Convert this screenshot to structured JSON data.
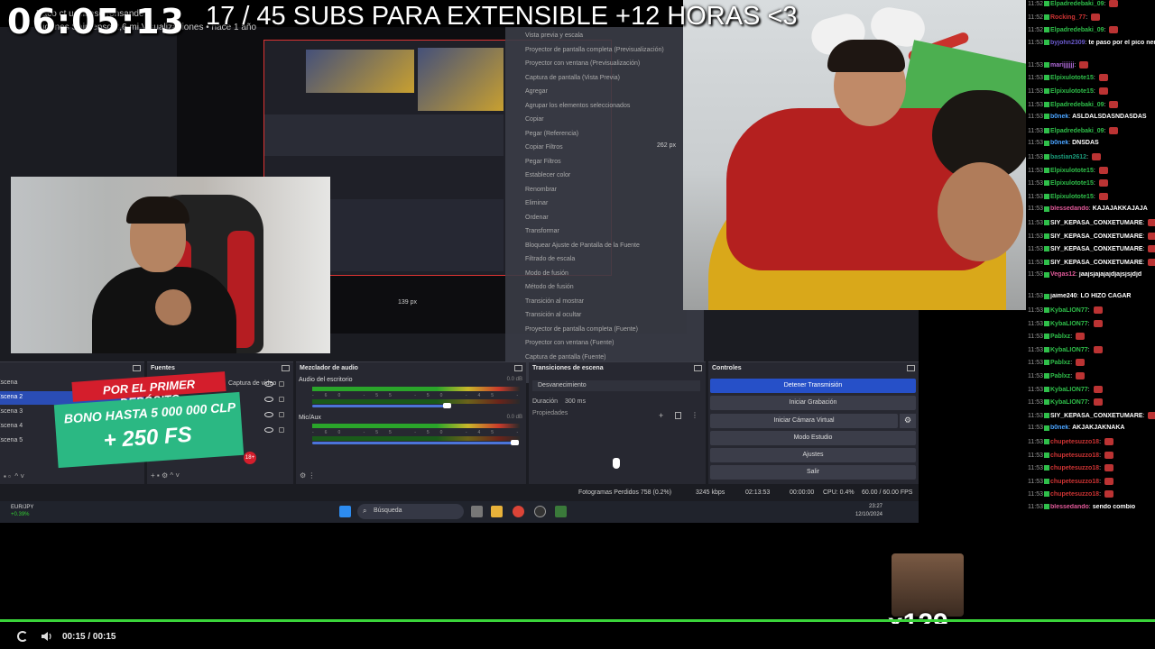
{
  "overlay": {
    "timer": "06:05:13",
    "subs_goal": "17 / 45 SUBS PARA EXTENSIBLE +12 HORAS <3",
    "title_line1": "Paco ct        ucfilfiasd        ronsando",
    "title_line2": "cliganes Saimenso 2,6 mi Visualizaciones • hace 1 año"
  },
  "preview": {
    "px_label_1": "139 px",
    "px_label_2": "262 px",
    "context_menu_items": [
      "Vista previa y escala",
      "Proyector de pantalla completa (Previsualización)",
      "Proyector con ventana (Previsualización)",
      "Captura de pantalla (Vista Previa)",
      "Agregar",
      "Agrupar los elementos seleccionados",
      "Copiar",
      "Pegar (Referencia)",
      "Copiar Filtros",
      "Pegar Filtros",
      "Establecer color",
      "Renombrar",
      "Eliminar",
      "Ordenar",
      "Transformar",
      "Bloquear Ajuste de Pantalla de la Fuente",
      "Filtrado de escala",
      "Modo de fusión",
      "Método de fusión",
      "Transición al mostrar",
      "Transición al ocultar",
      "Proyector de pantalla completa (Fuente)",
      "Proyector con ventana (Fuente)",
      "Captura de pantalla (Fuente)"
    ]
  },
  "docks": {
    "escenas": {
      "title": "",
      "items": [
        "Escena",
        "Escena 2",
        "Escena 3",
        "Escena 4",
        "Escena 5"
      ],
      "active_index": 1
    },
    "fuentes": {
      "title": "Fuentes",
      "items": [
        "Captura de video",
        "",
        "",
        ""
      ]
    },
    "mezclador": {
      "title": "Mezclador de audio",
      "channels": [
        {
          "label": "Audio del escritorio",
          "db": "0.0 dB",
          "level": 0.65
        },
        {
          "label": "Mic/Aux",
          "db": "0.0 dB",
          "level": 0.98
        }
      ],
      "scale": "-60 -55 -50 -45 -40 -35 -30 -25 -20 -15 -10 -5 0"
    },
    "transiciones": {
      "title": "Transiciones de escena",
      "transition": "Desvanecimiento",
      "duration_label": "Duración",
      "duration_value": "300 ms",
      "properties": "Propiedades"
    },
    "controles": {
      "title": "Controles",
      "buttons": [
        "Detener Transmisión",
        "Iniciar Grabación",
        "Iniciar Cámara Virtual",
        "Modo Estudio",
        "Ajustes",
        "Salir"
      ]
    }
  },
  "promo": {
    "top": "POR EL PRIMER DEPÓSITO",
    "bono": "BONO HASTA 5 000 000 CLP",
    "fs": "+ 250 FS",
    "age": "18+"
  },
  "statusbar": {
    "dropped": "Fotogramas Perdidos 758 (0.2%)",
    "kbps": "3245 kbps",
    "live_time": "02:13:53",
    "rec_time": "00:00:00",
    "cpu": "CPU: 0.4%",
    "fps": "60.00 / 60.00 FPS"
  },
  "taskbar": {
    "ticker_name": "EUR/JPY",
    "ticker_pct": "+0.39%",
    "search_placeholder": "Búsqueda",
    "time": "23:27",
    "date": "12/10/2024"
  },
  "chat": [
    {
      "time": "11:52",
      "user": "Elpadredebaki_09",
      "msg": "",
      "color": "#2fbf4a"
    },
    {
      "time": "11:52",
      "user": "Rocking_77",
      "msg": "",
      "color": "#c33"
    },
    {
      "time": "11:52",
      "user": "Elpadredebaki_09",
      "msg": "",
      "color": "#2fbf4a"
    },
    {
      "time": "11:53",
      "user": "byjohn2309",
      "msg": "te paso por el pico nenito",
      "color": "#6a5acd"
    },
    {
      "time": "11:53",
      "user": "marijjjjjj",
      "msg": "",
      "color": "#b06ad9"
    },
    {
      "time": "11:53",
      "user": "Elpixulotote15",
      "msg": "",
      "color": "#2fbf4a"
    },
    {
      "time": "11:53",
      "user": "Elpixulotote15",
      "msg": "",
      "color": "#2fbf4a"
    },
    {
      "time": "11:53",
      "user": "Elpadredebaki_09",
      "msg": "",
      "color": "#2fbf4a"
    },
    {
      "time": "11:53",
      "user": "b0nek",
      "msg": "ASLDALSDASÑDASDAS",
      "color": "#4aa3ff"
    },
    {
      "time": "11:53",
      "user": "Elpadredebaki_09",
      "msg": "",
      "color": "#2fbf4a"
    },
    {
      "time": "11:53",
      "user": "b0nek",
      "msg": "DÑSDAS",
      "color": "#4aa3ff"
    },
    {
      "time": "11:53",
      "user": "bastian2612",
      "msg": "",
      "color": "#1a9a7a"
    },
    {
      "time": "11:53",
      "user": "Elpixulotote15",
      "msg": "",
      "color": "#2fbf4a"
    },
    {
      "time": "11:53",
      "user": "Elpixulotote15",
      "msg": "",
      "color": "#2fbf4a"
    },
    {
      "time": "11:53",
      "user": "Elpixulotote15",
      "msg": "",
      "color": "#2fbf4a"
    },
    {
      "time": "11:53",
      "user": "blessedando",
      "msg": "KAJAJAKKAJAJA",
      "color": "#e25a9a"
    },
    {
      "time": "11:53",
      "user": "SIY_KEPASA_CONXETUMARE",
      "msg": "",
      "color": "#fff"
    },
    {
      "time": "11:53",
      "user": "SIY_KEPASA_CONXETUMARE",
      "msg": "",
      "color": "#fff"
    },
    {
      "time": "11:53",
      "user": "SIY_KEPASA_CONXETUMARE",
      "msg": "",
      "color": "#fff"
    },
    {
      "time": "11:53",
      "user": "SIY_KEPASA_CONXETUMARE",
      "msg": "",
      "color": "#fff"
    },
    {
      "time": "11:53",
      "user": "Vegas12",
      "msg": "jaajsjajajajdjajsjsjdjd",
      "color": "#e25a9a"
    },
    {
      "time": "11:53",
      "user": "jaime240",
      "msg": "LO HIZO CAGAR",
      "color": "#fff"
    },
    {
      "time": "11:53",
      "user": "KybaLION77",
      "msg": "",
      "color": "#2fbf4a"
    },
    {
      "time": "11:53",
      "user": "KybaLION77",
      "msg": "",
      "color": "#2fbf4a"
    },
    {
      "time": "11:53",
      "user": "Pablxz",
      "msg": "",
      "color": "#2fbf4a"
    },
    {
      "time": "11:53",
      "user": "KybaLION77",
      "msg": "",
      "color": "#2fbf4a"
    },
    {
      "time": "11:53",
      "user": "Pablxz",
      "msg": "",
      "color": "#2fbf4a"
    },
    {
      "time": "11:53",
      "user": "Pablxz",
      "msg": "",
      "color": "#2fbf4a"
    },
    {
      "time": "11:53",
      "user": "KybaLION77",
      "msg": "",
      "color": "#2fbf4a"
    },
    {
      "time": "11:53",
      "user": "KybaLION77",
      "msg": "",
      "color": "#2fbf4a"
    },
    {
      "time": "11:53",
      "user": "SIY_KEPASA_CONXETUMARE",
      "msg": "",
      "color": "#fff"
    },
    {
      "time": "11:53",
      "user": "b0nek",
      "msg": "AKJAKJAKÑAKA",
      "color": "#4aa3ff"
    },
    {
      "time": "11:53",
      "user": "chupetesuzzo18",
      "msg": "",
      "color": "#c33"
    },
    {
      "time": "11:53",
      "user": "chupetesuzzo18",
      "msg": "",
      "color": "#c33"
    },
    {
      "time": "11:53",
      "user": "chupetesuzzo18",
      "msg": "",
      "color": "#c33"
    },
    {
      "time": "11:53",
      "user": "chupetesuzzo18",
      "msg": "",
      "color": "#c33"
    },
    {
      "time": "11:53",
      "user": "chupetesuzzo18",
      "msg": "",
      "color": "#c33"
    },
    {
      "time": "11:53",
      "user": "blessedando",
      "msg": "sendo combio",
      "color": "#e25a9a"
    }
  ],
  "emote": {
    "count": "x129"
  },
  "player": {
    "time": "00:15 / 00:15",
    "progress": 1.0
  },
  "colors": {
    "accent": "#2650c8",
    "progress": "#3ad43a",
    "promo_green": "#2bb883",
    "promo_red": "#d41e2c"
  }
}
